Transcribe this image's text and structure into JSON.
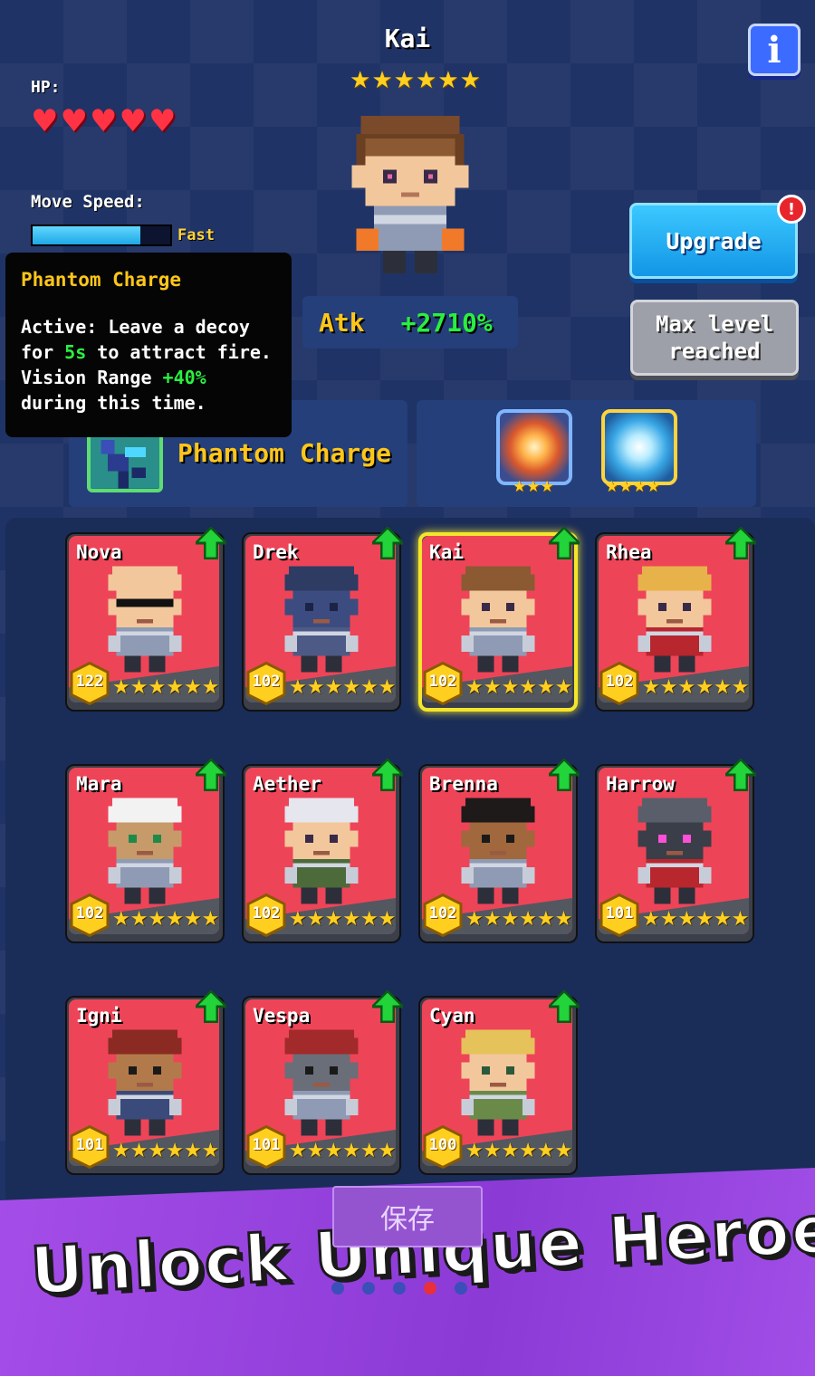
{
  "header": {
    "hero_name": "Kai",
    "hero_stars": 6,
    "info_label": "i"
  },
  "stats": {
    "hp_label": "HP:",
    "hp_hearts": 5,
    "move_speed_label": "Move Speed:",
    "move_speed_value": "Fast",
    "move_speed_fill": 0.78,
    "atk_label": "Atk",
    "atk_value": "+2710%"
  },
  "buttons": {
    "upgrade": "Upgrade",
    "upgrade_alert": "!",
    "max_level": "Max level reached",
    "save": "保存"
  },
  "tooltip": {
    "title": "Phantom Charge",
    "line1_a": "Active: Leave a decoy",
    "line2_a": "for ",
    "line2_hl": "5s",
    "line2_b": " to attract fire.",
    "line3_a": "Vision Range ",
    "line3_hl": "+40%",
    "line4": "during this time."
  },
  "skill": {
    "name": "Phantom Charge",
    "icon": "phantom-charge-icon"
  },
  "gear": [
    {
      "icon": "explosion-icon",
      "stars": 3
    },
    {
      "icon": "ice-shatter-icon",
      "stars": 4
    }
  ],
  "heroes": [
    {
      "name": "Nova",
      "level": "122",
      "stars": 6,
      "selected": false,
      "look": "bald-sunglasses"
    },
    {
      "name": "Drek",
      "level": "102",
      "stars": 6,
      "selected": false,
      "look": "helmet"
    },
    {
      "name": "Kai",
      "level": "102",
      "stars": 6,
      "selected": true,
      "look": "brown-hair"
    },
    {
      "name": "Rhea",
      "level": "102",
      "stars": 6,
      "selected": false,
      "look": "blonde-ponytail"
    },
    {
      "name": "Mara",
      "level": "102",
      "stars": 6,
      "selected": false,
      "look": "white-spiky"
    },
    {
      "name": "Aether",
      "level": "102",
      "stars": 6,
      "selected": false,
      "look": "white-long"
    },
    {
      "name": "Brenna",
      "level": "102",
      "stars": 6,
      "selected": false,
      "look": "curly-dark"
    },
    {
      "name": "Harrow",
      "level": "101",
      "stars": 6,
      "selected": false,
      "look": "robot-visor"
    },
    {
      "name": "Igni",
      "level": "101",
      "stars": 6,
      "selected": false,
      "look": "red-spiky"
    },
    {
      "name": "Vespa",
      "level": "101",
      "stars": 6,
      "selected": false,
      "look": "red-mask"
    },
    {
      "name": "Cyan",
      "level": "100",
      "stars": 6,
      "selected": false,
      "look": "blond-spiky"
    }
  ],
  "promo": {
    "headline": "Unlock Unique Heroes!",
    "page_dots": 5,
    "active_dot": 3
  },
  "colors": {
    "background": "#1f3366",
    "card_red": "#ee4458",
    "star_gold": "#ffcf1f",
    "atk_green": "#2aef40",
    "skill_gold": "#ffc619",
    "upgrade_blue": "#1ea7e6",
    "promo_purple": "#9a45e0"
  }
}
